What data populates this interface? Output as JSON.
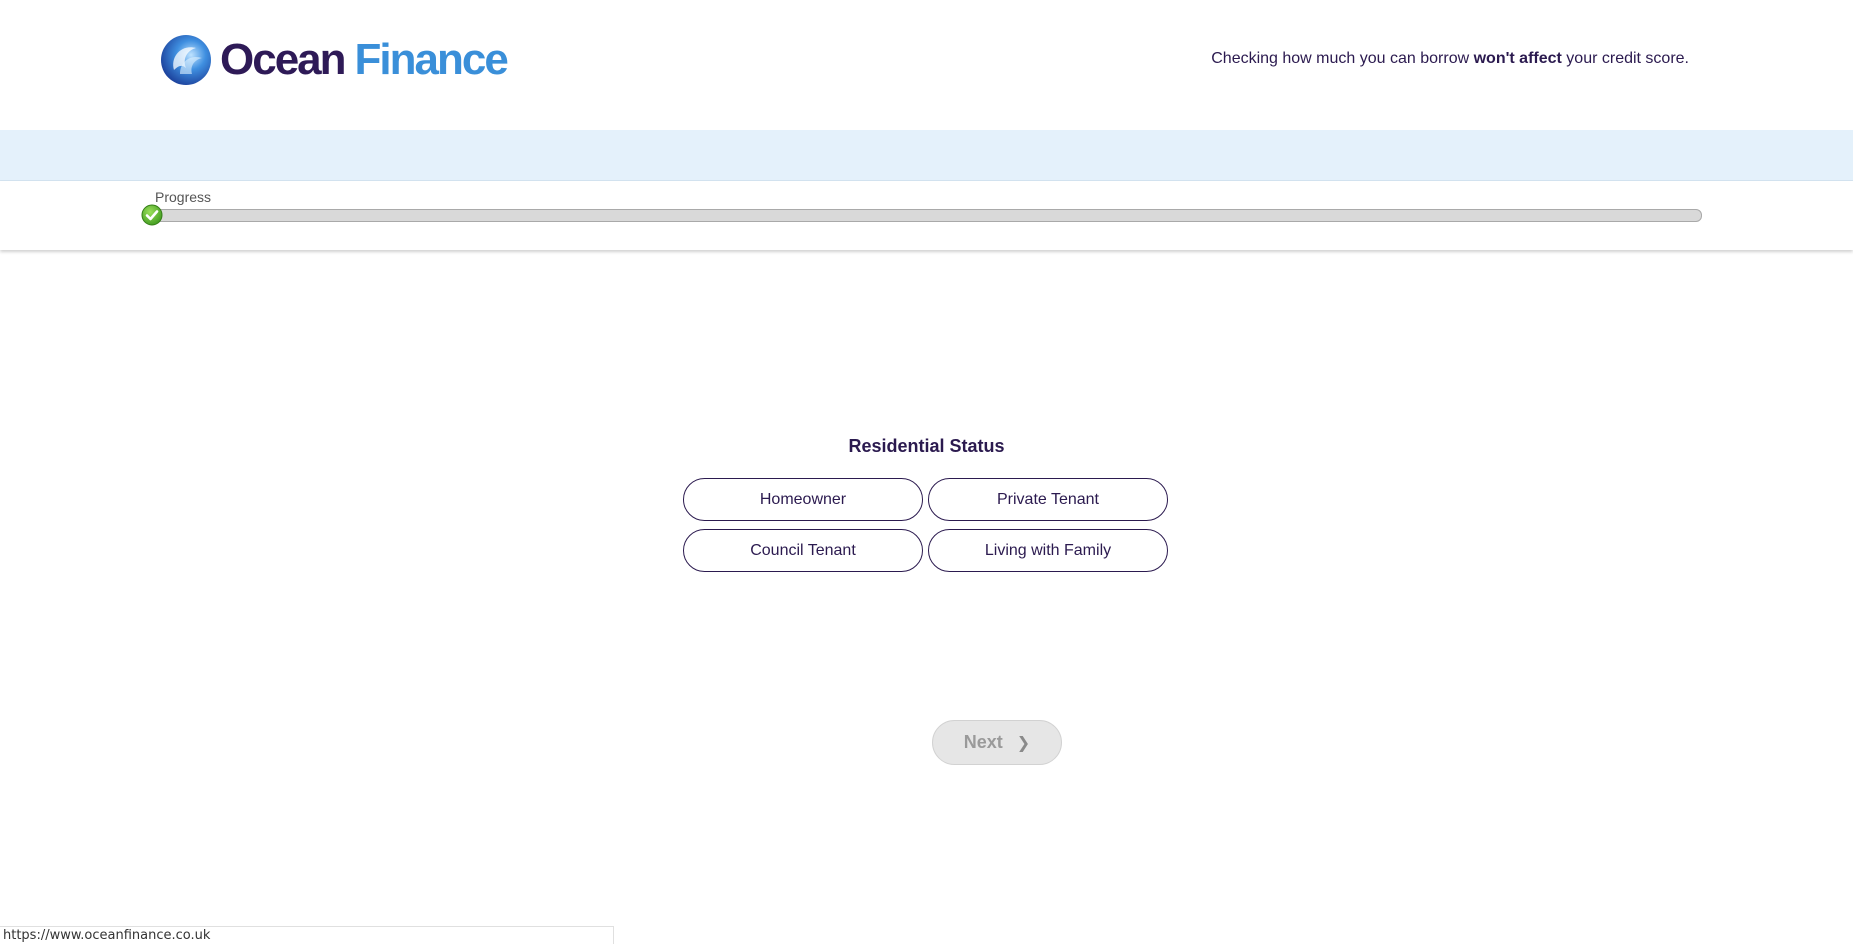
{
  "brand": {
    "name_part_1": "Ocean",
    "name_part_2": "Finance",
    "logo_icon": "ocean-swirl-logo",
    "colors": {
      "primary": "#2e1a57",
      "accent": "#3a8fd9"
    }
  },
  "header": {
    "tagline_pre": "Checking how much you can borrow ",
    "tagline_bold": "won't affect",
    "tagline_post": " your credit score."
  },
  "progress": {
    "label": "Progress",
    "percent": 0,
    "status_icon": "check-icon",
    "color": "#6cb33f"
  },
  "form": {
    "question": "Residential Status",
    "options": [
      {
        "label": "Homeowner"
      },
      {
        "label": "Private Tenant"
      },
      {
        "label": "Council Tenant"
      },
      {
        "label": "Living with Family"
      }
    ],
    "next_label": "Next",
    "next_icon": "chevron-right-icon",
    "next_disabled": true
  },
  "statusbar": {
    "url": "https://www.oceanfinance.co.uk"
  }
}
